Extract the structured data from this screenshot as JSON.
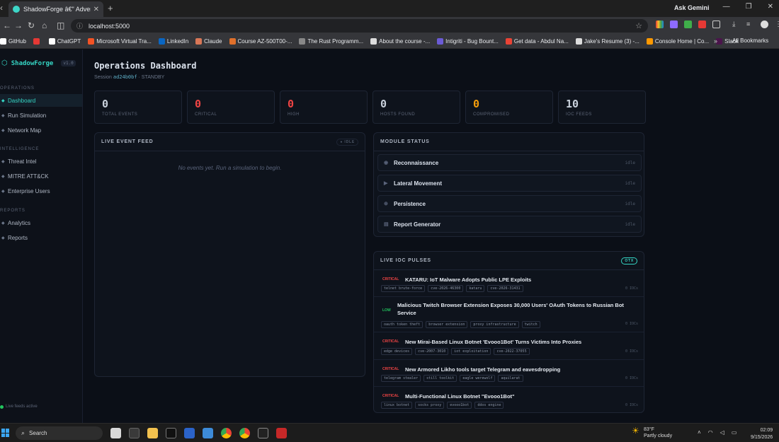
{
  "browser": {
    "tab_title": "ShadowForge â€\" Adversary Em",
    "url": "localhost:5000",
    "ask_gemini": "Ask Gemini",
    "bookmarks": [
      "GitHub",
      "",
      "ChatGPT",
      "Microsoft Virtual Tra...",
      "LinkedIn",
      "Claude",
      "Course AZ-500T00-...",
      "The Rust Programm...",
      "About the course -...",
      "Intigriti - Bug Bount...",
      "Get data - Abdul Na...",
      "Jake's Resume (3) -...",
      "Console Home | Co...",
      "Slack"
    ],
    "all_bookmarks": "All Bookmarks"
  },
  "sidebar": {
    "brand": "ShadowForge",
    "version": "v1.0",
    "sections": [
      {
        "title": "OPERATIONS",
        "items": [
          "Dashboard",
          "Run Simulation",
          "Network Map"
        ]
      },
      {
        "title": "INTELLIGENCE",
        "items": [
          "Threat Intel",
          "MITRE ATT&CK",
          "Enterprise Users"
        ]
      },
      {
        "title": "REPORTS",
        "items": [
          "Analytics",
          "Reports"
        ]
      }
    ],
    "live_status": "Live feeds active"
  },
  "main": {
    "title": "Operations Dashboard",
    "session_label": "Session",
    "session_id": "ad24b0bf",
    "session_state": "· STANDBY"
  },
  "stats": [
    {
      "value": "0",
      "label": "TOTAL EVENTS",
      "color": "#c9d1dc"
    },
    {
      "value": "0",
      "label": "CRITICAL",
      "color": "#ef4444"
    },
    {
      "value": "0",
      "label": "HIGH",
      "color": "#ef4444"
    },
    {
      "value": "0",
      "label": "HOSTS FOUND",
      "color": "#c9d1dc"
    },
    {
      "value": "0",
      "label": "COMPROMISED",
      "color": "#f59e0b"
    },
    {
      "value": "10",
      "label": "IOC FEEDS",
      "color": "#c9d1dc"
    }
  ],
  "event_feed": {
    "title": "LIVE EVENT FEED",
    "badge": "● IDLE",
    "empty": "No events yet. Run a simulation to begin."
  },
  "modules": {
    "title": "MODULE STATUS",
    "items": [
      {
        "icon": "◉",
        "name": "Reconnaissance",
        "status": "idle"
      },
      {
        "icon": "▶",
        "name": "Lateral Movement",
        "status": "idle"
      },
      {
        "icon": "⊕",
        "name": "Persistence",
        "status": "idle"
      },
      {
        "icon": "▤",
        "name": "Report Generator",
        "status": "idle"
      }
    ]
  },
  "ioc": {
    "title": "LIVE IOC PULSES",
    "badge": "OTX",
    "pulses": [
      {
        "severity": "CRITICAL",
        "title": "KATARU: IoT Malware Adopts Public LPE Exploits",
        "tags": [
          "telnet brute-force",
          "cve-2026-46300",
          "kataru",
          "cve-2026-31431"
        ],
        "count": "0 IOCs"
      },
      {
        "severity": "LOW",
        "title": "Malicious Twitch Browser Extension Exposes 30,000 Users' OAuth Tokens to Russian Bot Service",
        "tags": [
          "oauth token theft",
          "browser extension",
          "proxy infrastructure",
          "twitch"
        ],
        "count": "0 IOCs"
      },
      {
        "severity": "CRITICAL",
        "title": "New Mirai-Based Linux Botnet 'Evooo1Bot' Turns Victims Into Proxies",
        "tags": [
          "edge devices",
          "cve-2007-3010",
          "iot exploitation",
          "cve-2022-37055"
        ],
        "count": "0 IOCs"
      },
      {
        "severity": "CRITICAL",
        "title": "New Armored Likho tools target Telegram and eavesdropping",
        "tags": [
          "telegram stealer",
          "still toolkit",
          "eagle werewolf",
          "aquilarat"
        ],
        "count": "0 IOCs"
      },
      {
        "severity": "CRITICAL",
        "title": "Multi-Functional Linux Botnet \"Evooo1Bot\"",
        "tags": [
          "linux botnet",
          "socks proxy",
          "evooo1bot",
          "ddos engine"
        ],
        "count": "0 IOCs"
      }
    ]
  },
  "taskbar": {
    "search": "Search",
    "temp": "83°F",
    "weather": "Partly cloudy",
    "time": "02:09",
    "date": "9/15/2026"
  }
}
